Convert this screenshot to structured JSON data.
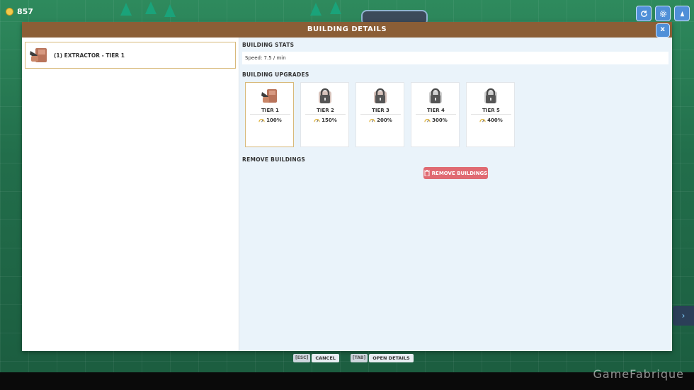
{
  "hud": {
    "coins": "857",
    "top_icons": [
      "refresh-icon",
      "settings-icon",
      "stats-icon"
    ]
  },
  "modal": {
    "title": "BUILDING DETAILS",
    "close_label": "x"
  },
  "building_list": [
    {
      "label": "(1) EXTRACTOR - TIER 1",
      "icon": "extractor-icon"
    }
  ],
  "stats": {
    "title": "BUILDING STATS",
    "speed": "Speed: 7.5 / min"
  },
  "upgrades": {
    "title": "BUILDING UPGRADES",
    "tiers": [
      {
        "name": "TIER 1",
        "speed": "100%",
        "locked": false
      },
      {
        "name": "TIER 2",
        "speed": "150%",
        "locked": true
      },
      {
        "name": "TIER 3",
        "speed": "200%",
        "locked": true
      },
      {
        "name": "TIER 4",
        "speed": "300%",
        "locked": true
      },
      {
        "name": "TIER 5",
        "speed": "400%",
        "locked": true
      }
    ]
  },
  "remove": {
    "title": "REMOVE BUILDINGS",
    "button_label": "REMOVE BUILDINGS"
  },
  "footer": {
    "cancel_key": "[ESC]",
    "cancel_label": "CANCEL",
    "details_key": "[TAB]",
    "details_label": "OPEN DETAILS"
  },
  "watermark": "GameFabrique",
  "colors": {
    "header": "#8b5e36",
    "selected_border": "#d8b97a",
    "remove_button": "#e06a72",
    "hud_button": "#4f8fd8"
  }
}
